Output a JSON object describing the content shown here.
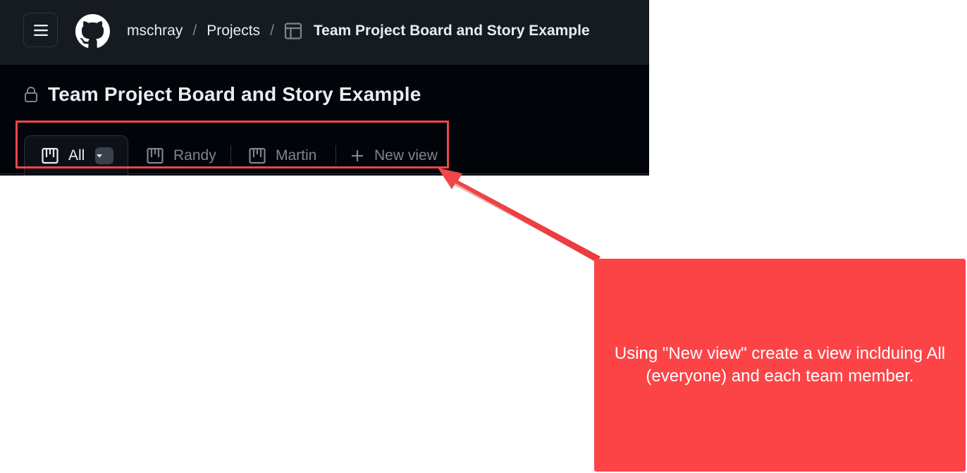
{
  "header": {
    "owner": "mschray",
    "separator": "/",
    "projects_label": "Projects",
    "project_name": "Team Project Board and Story Example"
  },
  "page": {
    "title": "Team Project Board and Story Example"
  },
  "views": {
    "tabs": [
      {
        "label": "All",
        "icon": "board-icon",
        "active": true
      },
      {
        "label": "Randy",
        "icon": "board-icon",
        "active": false
      },
      {
        "label": "Martin",
        "icon": "board-icon",
        "active": false
      }
    ],
    "new_view_label": "New view"
  },
  "annotation": {
    "text": "Using \"New view\" create a view inclduing All (everyone) and each team member.",
    "color": "#fc4447"
  },
  "colors": {
    "header_bg": "#161b22",
    "page_bg": "#010409",
    "text": "#e6edf3",
    "muted": "#7d8590"
  }
}
